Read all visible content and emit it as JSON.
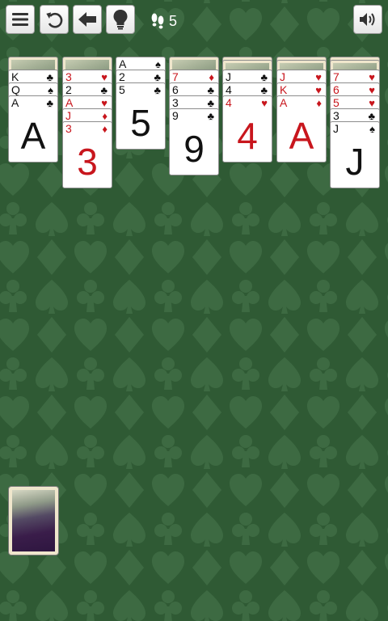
{
  "toolbar": {
    "menu_icon": "hamburger-menu-icon",
    "undo_icon": "undo-icon",
    "back_icon": "arrow-left-icon",
    "hint_icon": "lightbulb-icon",
    "moves_icon": "footprints-icon",
    "moves_count": "5",
    "sound_icon": "speaker-icon"
  },
  "colors": {
    "felt": "#2f5a34",
    "felt_pattern": "#3d6a42",
    "red_suit": "#c8161d",
    "black_suit": "#111111"
  },
  "tableau": [
    {
      "facedown": 1,
      "cards": [
        {
          "rank": "K",
          "suit": "♣",
          "color": "black"
        },
        {
          "rank": "Q",
          "suit": "♠",
          "color": "black"
        },
        {
          "rank": "A",
          "suit": "♣",
          "color": "black"
        }
      ]
    },
    {
      "facedown": 1,
      "cards": [
        {
          "rank": "3",
          "suit": "♥",
          "color": "red"
        },
        {
          "rank": "2",
          "suit": "♣",
          "color": "black"
        },
        {
          "rank": "A",
          "suit": "♥",
          "color": "red"
        },
        {
          "rank": "J",
          "suit": "♦",
          "color": "red"
        },
        {
          "rank": "3",
          "suit": "♦",
          "color": "red"
        }
      ]
    },
    {
      "facedown": 0,
      "cards": [
        {
          "rank": "A",
          "suit": "♠",
          "color": "black"
        },
        {
          "rank": "2",
          "suit": "♣",
          "color": "black"
        },
        {
          "rank": "5",
          "suit": "♣",
          "color": "black"
        }
      ]
    },
    {
      "facedown": 1,
      "cards": [
        {
          "rank": "7",
          "suit": "♦",
          "color": "red"
        },
        {
          "rank": "6",
          "suit": "♣",
          "color": "black"
        },
        {
          "rank": "3",
          "suit": "♣",
          "color": "black"
        },
        {
          "rank": "9",
          "suit": "♣",
          "color": "black"
        }
      ]
    },
    {
      "facedown": 2,
      "cards": [
        {
          "rank": "J",
          "suit": "♣",
          "color": "black"
        },
        {
          "rank": "4",
          "suit": "♣",
          "color": "black"
        },
        {
          "rank": "4",
          "suit": "♥",
          "color": "red"
        }
      ]
    },
    {
      "facedown": 2,
      "cards": [
        {
          "rank": "J",
          "suit": "♥",
          "color": "red"
        },
        {
          "rank": "K",
          "suit": "♥",
          "color": "red"
        },
        {
          "rank": "A",
          "suit": "♦",
          "color": "red"
        }
      ]
    },
    {
      "facedown": 2,
      "cards": [
        {
          "rank": "7",
          "suit": "♥",
          "color": "red"
        },
        {
          "rank": "6",
          "suit": "♥",
          "color": "red"
        },
        {
          "rank": "5",
          "suit": "♥",
          "color": "red"
        },
        {
          "rank": "3",
          "suit": "♣",
          "color": "black"
        },
        {
          "rank": "J",
          "suit": "♠",
          "color": "black"
        }
      ]
    }
  ],
  "stock": {
    "card_back": "card-back"
  }
}
